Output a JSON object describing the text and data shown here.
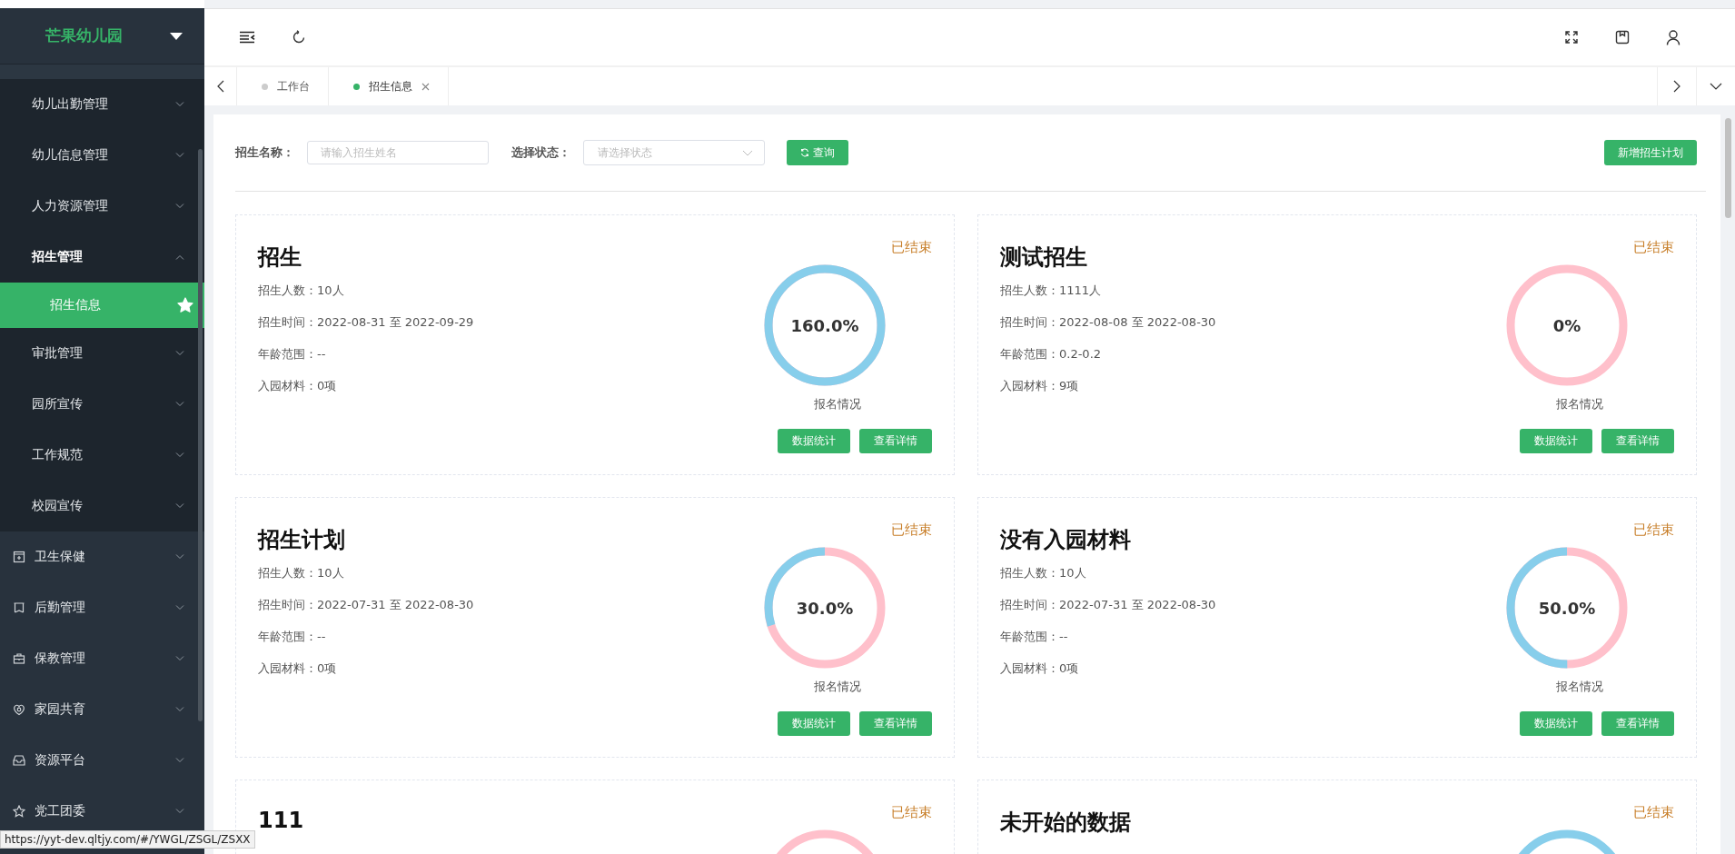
{
  "sidebar": {
    "school": "芒果幼儿园",
    "items": [
      {
        "label": "幼儿出勤管理",
        "kind": "sub",
        "expanded": false
      },
      {
        "label": "幼儿信息管理",
        "kind": "sub",
        "expanded": false
      },
      {
        "label": "人力资源管理",
        "kind": "sub",
        "expanded": false
      },
      {
        "label": "招生管理",
        "kind": "sub",
        "expanded": true,
        "children": [
          {
            "label": "招生信息",
            "selected": true
          }
        ]
      },
      {
        "label": "审批管理",
        "kind": "sub",
        "expanded": false
      },
      {
        "label": "园所宣传",
        "kind": "sub",
        "expanded": false
      },
      {
        "label": "工作规范",
        "kind": "sub",
        "expanded": false
      },
      {
        "label": "校园宣传",
        "kind": "sub",
        "expanded": false
      },
      {
        "label": "卫生保健",
        "kind": "top",
        "expanded": false
      },
      {
        "label": "后勤管理",
        "kind": "top",
        "expanded": false
      },
      {
        "label": "保教管理",
        "kind": "top",
        "expanded": false
      },
      {
        "label": "家园共育",
        "kind": "top",
        "expanded": false
      },
      {
        "label": "资源平台",
        "kind": "top",
        "expanded": false
      },
      {
        "label": "党工团委",
        "kind": "top",
        "expanded": false
      }
    ]
  },
  "tabs": [
    {
      "label": "工作台",
      "selected": false
    },
    {
      "label": "招生信息",
      "selected": true
    }
  ],
  "filter": {
    "name_label": "招生名称：",
    "name_placeholder": "请输入招生姓名",
    "status_label": "选择状态：",
    "status_placeholder": "请选择状态",
    "query_button": "查询",
    "add_button": "新增招生计划"
  },
  "cards": [
    {
      "title": "招生",
      "status": "已结束",
      "lines": [
        "招生人数：10人",
        "招生时间：2022-08-31 至 2022-09-29",
        "年龄范围：--",
        "入园材料：0项"
      ],
      "percent": "160.0%",
      "level": 1,
      "caption": "报名情况",
      "buttons": [
        "数据统计",
        "查看详情"
      ]
    },
    {
      "title": "测试招生",
      "status": "已结束",
      "lines": [
        "招生人数：1111人",
        "招生时间：2022-08-08 至 2022-08-30",
        "年龄范围：0.2-0.2",
        "入园材料：9项"
      ],
      "percent": "0%",
      "level": 0,
      "caption": "报名情况",
      "buttons": [
        "数据统计",
        "查看详情"
      ]
    },
    {
      "title": "招生计划",
      "status": "已结束",
      "lines": [
        "招生人数：10人",
        "招生时间：2022-07-31 至 2022-08-30",
        "年龄范围：--",
        "入园材料：0项"
      ],
      "percent": "30.0%",
      "level": 0.3,
      "caption": "报名情况",
      "buttons": [
        "数据统计",
        "查看详情"
      ]
    },
    {
      "title": "没有入园材料",
      "status": "已结束",
      "lines": [
        "招生人数：10人",
        "招生时间：2022-07-31 至 2022-08-30",
        "年龄范围：--",
        "入园材料：0项"
      ],
      "percent": "50.0%",
      "level": 0.5,
      "caption": "报名情况",
      "buttons": [
        "数据统计",
        "查看详情"
      ]
    },
    {
      "title": "111",
      "status": "已结束",
      "color": "#ffc0cb"
    },
    {
      "title": "未开始的数据",
      "status": "已结束",
      "color": "#87ceeb"
    }
  ],
  "status_url": "https://yyt-dev.qltjy.com/#/YWGL/ZSGL/ZSXX"
}
